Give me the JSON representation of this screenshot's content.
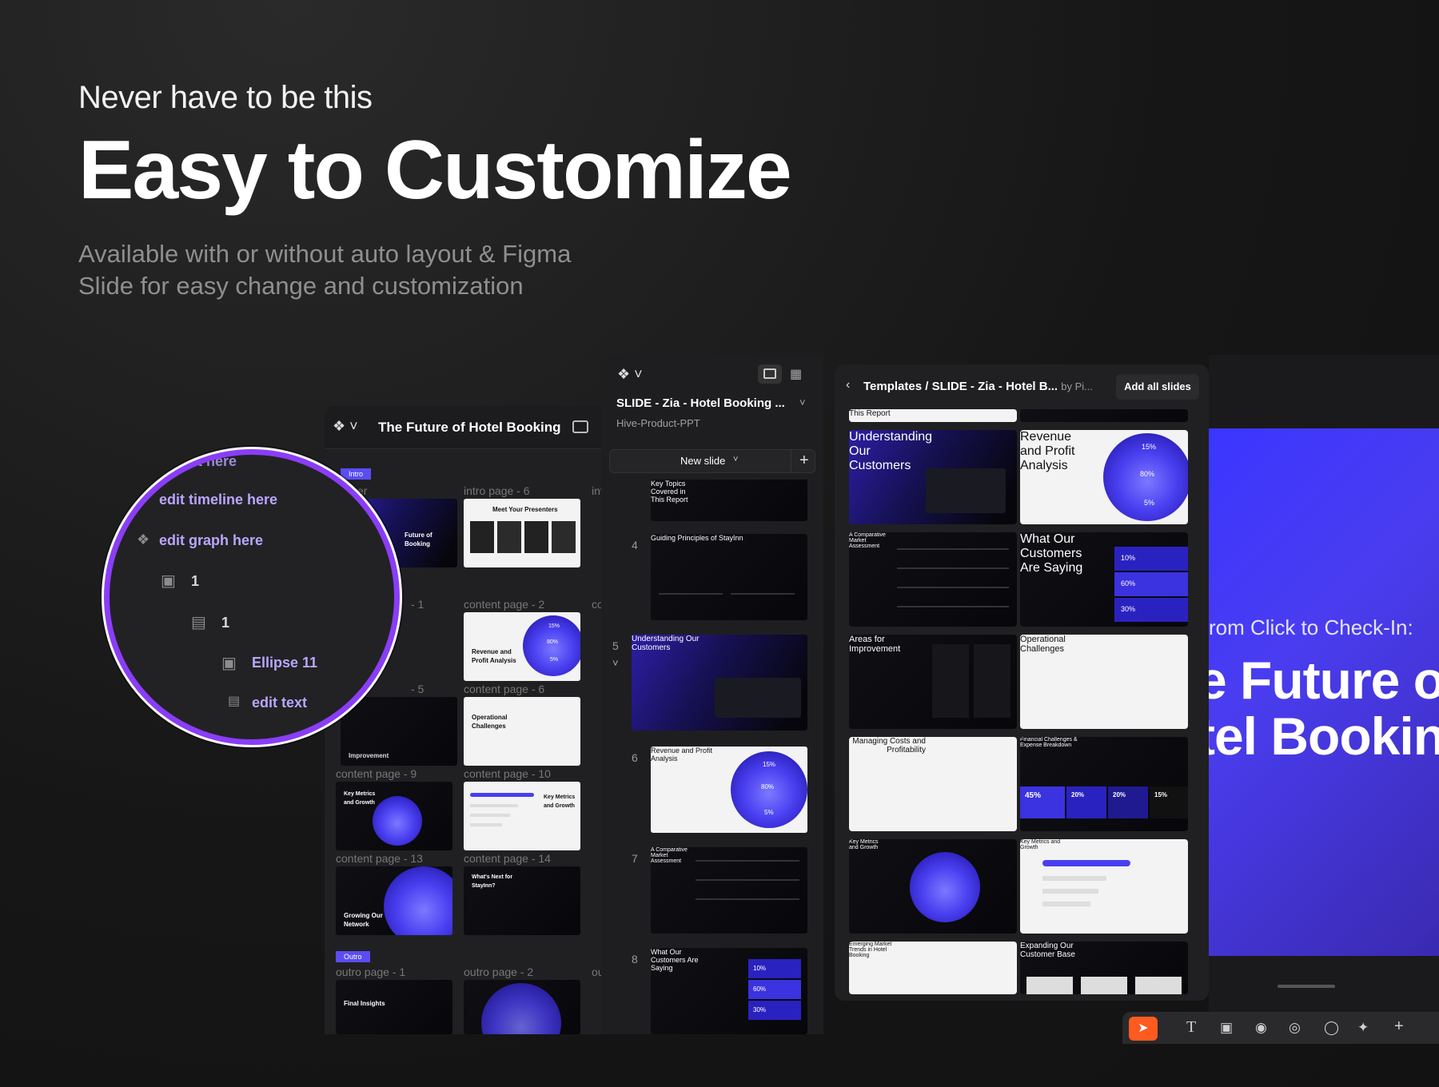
{
  "hero": {
    "eyebrow": "Never have to be this",
    "headline": "Easy to Customize",
    "subtitle": "Available with or without auto layout  & Figma Slide for easy change and customization"
  },
  "left_panel": {
    "title": "The Future of Hotel Booking",
    "section_intro": "Intro",
    "section_outro": "Outro",
    "labels": {
      "intro6": "intro page - 6",
      "content2": "content page - 2",
      "content6": "content page - 6",
      "content9": "content page - 9",
      "content10": "content page - 10",
      "content13": "content page - 13",
      "content14": "content page - 14",
      "outro1": "outro page - 1",
      "outro2": "outro page - 2",
      "frag_ver": "ver",
      "frag_int": "int",
      "frag_1": "- 1",
      "frag_5": "- 5",
      "frag_co": "co",
      "frag_ou": "ou"
    },
    "slides": {
      "presenters": "Meet Your Presenters",
      "future": "Future of Booking",
      "revenue": "Revenue and Profit Analysis",
      "operational": "Operational Challenges",
      "improvement": "Improvement",
      "key_metrics": "Key Metrics and Growth",
      "key_metrics_b": "Key Metrics and Growth",
      "growing": "Growing Our Network",
      "whats_next": "What's Next for StayInn?",
      "final": "Final Insights",
      "pct15": "15%",
      "pct80": "80%",
      "pct5": "5%"
    }
  },
  "magnifier": {
    "row0": "t here",
    "row1": "edit timeline here",
    "row2": "edit graph here",
    "row3": "1",
    "row4": "1",
    "row5": "Ellipse 11",
    "row6": "edit text"
  },
  "mid_panel": {
    "file": "SLIDE - Zia - Hotel Booking ...",
    "project": "Hive-Product-PPT",
    "new_slide": "New slide",
    "add": "+",
    "items": [
      {
        "num": "",
        "title": "Key Topics Covered in This Report"
      },
      {
        "num": "4",
        "title": "Guiding Principles of StayInn"
      },
      {
        "num": "5",
        "title": "Understanding Our Customers"
      },
      {
        "num": "6",
        "title": "Revenue and Profit Analysis"
      },
      {
        "num": "7",
        "title": "A Comparative Market Assessment"
      },
      {
        "num": "8",
        "title": "What Our Customers Are Saying"
      }
    ],
    "pct15": "15%",
    "pct80": "80%",
    "pct5": "5%",
    "pct10": "10%",
    "pct60": "60%",
    "pct30": "30%"
  },
  "tpl_panel": {
    "crumb": "Templates / SLIDE - Zia - Hotel B...",
    "by": "by Pi...",
    "add_all": "Add all slides",
    "top_partial": "This Report",
    "slides": {
      "understanding": "Understanding Our Customers",
      "revenue": "Revenue and Profit Analysis",
      "comparative": "A Comparative Market Assessment",
      "saying": "What Our Customers Are Saying",
      "areas": "Areas for Improvement",
      "operational": "Operational Challenges",
      "managing": "Managing Costs and Profitability",
      "financial": "Financial Challenges & Expense Breakdown",
      "key_metrics": "Key Metrics and Growth",
      "key_metrics_b": "Key Metrics and Growth",
      "emerging": "Emerging Market Trends in Hotel Booking",
      "expanding": "Expanding Our Customer Base",
      "pct15": "15%",
      "pct80": "80%",
      "pct5": "5%",
      "pct10": "10%",
      "pct60": "60%",
      "pct30": "30%",
      "pct45": "45%",
      "pct20a": "20%",
      "pct20b": "20%",
      "pct15b": "15%"
    }
  },
  "canvas": {
    "kicker": "rom Click to Check-In:",
    "line1": "e Future o",
    "line2": "tel Bookin"
  },
  "colors": {
    "accent": "#5b4df2",
    "magnifier_ring": "#8a3df6",
    "cover_blue": "#3b35ff",
    "toolbar_orange": "#ff5a1f"
  }
}
